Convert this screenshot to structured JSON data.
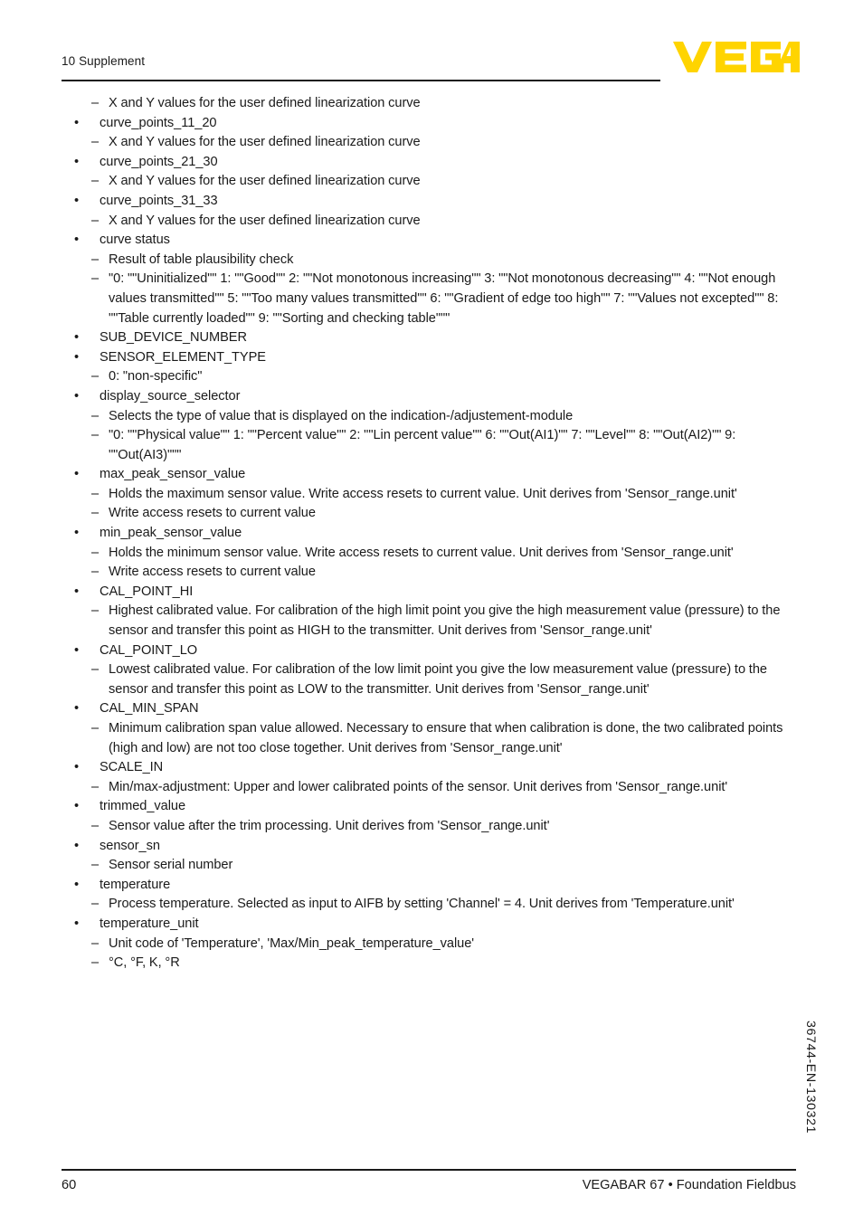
{
  "header": {
    "chapter": "10 Supplement",
    "logo_text": "VEGA",
    "logo_color": "#FFD400"
  },
  "footer": {
    "page_number": "60",
    "document_title": "VEGABAR 67 • Foundation Fieldbus",
    "doc_id": "36744-EN-130321"
  },
  "content": {
    "items": [
      {
        "level": 2,
        "marker": "–",
        "text": "X and Y values for the user defined linearization curve"
      },
      {
        "level": 1,
        "marker": "•",
        "text": "curve_points_11_20"
      },
      {
        "level": 2,
        "marker": "–",
        "text": "X and Y values for the user defined linearization curve"
      },
      {
        "level": 1,
        "marker": "•",
        "text": "curve_points_21_30"
      },
      {
        "level": 2,
        "marker": "–",
        "text": "X and Y values for the user defined linearization curve"
      },
      {
        "level": 1,
        "marker": "•",
        "text": "curve_points_31_33"
      },
      {
        "level": 2,
        "marker": "–",
        "text": "X and Y values for the user defined linearization curve"
      },
      {
        "level": 1,
        "marker": "•",
        "text": "curve status"
      },
      {
        "level": 2,
        "marker": "–",
        "text": "Result of table plausibility check"
      },
      {
        "level": 2,
        "marker": "–",
        "text": "\"0: \"\"Uninitialized\"\" 1: \"\"Good\"\" 2: \"\"Not monotonous increasing\"\" 3: \"\"Not monotonous decreasing\"\" 4: \"\"Not enough values transmitted\"\" 5: \"\"Too many values transmitted\"\" 6: \"\"Gradient of edge too high\"\" 7: \"\"Values not excepted\"\" 8: \"\"Table currently loaded\"\" 9: \"\"Sorting and checking table\"\"\""
      },
      {
        "level": 1,
        "marker": "•",
        "text": "SUB_DEVICE_NUMBER"
      },
      {
        "level": 1,
        "marker": "•",
        "text": "SENSOR_ELEMENT_TYPE"
      },
      {
        "level": 2,
        "marker": "–",
        "text": "0: \"non-specific\""
      },
      {
        "level": 1,
        "marker": "•",
        "text": "display_source_selector"
      },
      {
        "level": 2,
        "marker": "–",
        "text": "Selects the type of value that is displayed on the indication-/adjustement-module"
      },
      {
        "level": 2,
        "marker": "–",
        "text": "\"0: \"\"Physical value\"\" 1: \"\"Percent value\"\" 2: \"\"Lin percent value\"\" 6: \"\"Out(AI1)\"\" 7: \"\"Level\"\" 8: \"\"Out(AI2)\"\" 9: \"\"Out(AI3)\"\"\""
      },
      {
        "level": 1,
        "marker": "•",
        "text": "max_peak_sensor_value"
      },
      {
        "level": 2,
        "marker": "–",
        "text": "Holds the maximum sensor value. Write access resets to current value. Unit derives from 'Sensor_range.unit'"
      },
      {
        "level": 2,
        "marker": "–",
        "text": "Write access resets to current value"
      },
      {
        "level": 1,
        "marker": "•",
        "text": "min_peak_sensor_value"
      },
      {
        "level": 2,
        "marker": "–",
        "text": "Holds the minimum sensor value. Write access resets to current value. Unit derives from 'Sensor_range.unit'"
      },
      {
        "level": 2,
        "marker": "–",
        "text": "Write access resets to current value"
      },
      {
        "level": 1,
        "marker": "•",
        "text": "CAL_POINT_HI"
      },
      {
        "level": 2,
        "marker": "–",
        "text": "Highest calibrated value. For calibration of the high limit point you give the high measurement value (pressure) to the sensor and transfer this point as HIGH to the transmitter. Unit derives from 'Sensor_range.unit'"
      },
      {
        "level": 1,
        "marker": "•",
        "text": "CAL_POINT_LO"
      },
      {
        "level": 2,
        "marker": "–",
        "text": "Lowest calibrated value. For calibration of the low limit point you give the low measurement value (pressure) to the sensor and transfer this point as LOW to the transmitter. Unit derives from 'Sensor_range.unit'"
      },
      {
        "level": 1,
        "marker": "•",
        "text": "CAL_MIN_SPAN"
      },
      {
        "level": 2,
        "marker": "–",
        "text": "Minimum calibration span value allowed. Necessary to ensure that when calibration is done, the two calibrated points (high and low) are not too close together. Unit derives from 'Sensor_range.unit'"
      },
      {
        "level": 1,
        "marker": "•",
        "text": "SCALE_IN"
      },
      {
        "level": 2,
        "marker": "–",
        "text": "Min/max-adjustment: Upper and lower calibrated points of the sensor. Unit derives from 'Sensor_range.unit'"
      },
      {
        "level": 1,
        "marker": "•",
        "text": "trimmed_value"
      },
      {
        "level": 2,
        "marker": "–",
        "text": "Sensor value after the trim processing. Unit derives from 'Sensor_range.unit'"
      },
      {
        "level": 1,
        "marker": "•",
        "text": "sensor_sn"
      },
      {
        "level": 2,
        "marker": "–",
        "text": "Sensor serial number"
      },
      {
        "level": 1,
        "marker": "•",
        "text": "temperature"
      },
      {
        "level": 2,
        "marker": "–",
        "text": "Process temperature. Selected as input to AIFB by setting 'Channel' = 4. Unit derives from 'Temperature.unit'"
      },
      {
        "level": 1,
        "marker": "•",
        "text": "temperature_unit"
      },
      {
        "level": 2,
        "marker": "–",
        "text": "Unit code of 'Temperature', 'Max/Min_peak_temperature_value'"
      },
      {
        "level": 2,
        "marker": "–",
        "text": "°C, °F, K, °R"
      }
    ]
  }
}
